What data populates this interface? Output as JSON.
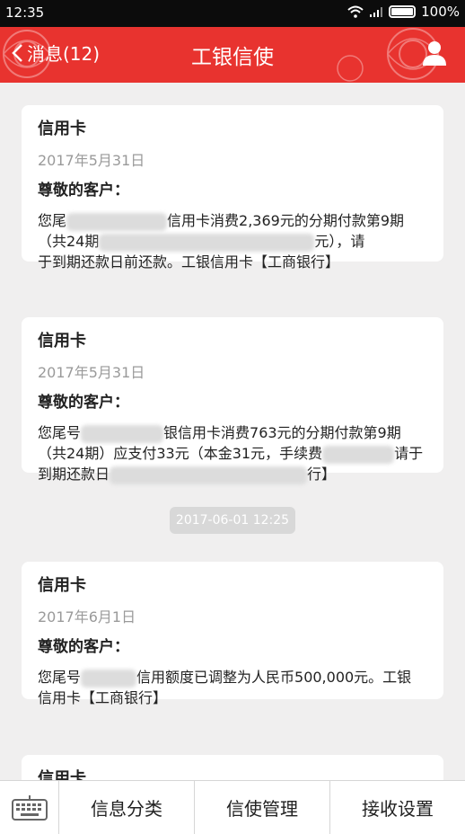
{
  "status_bar": {
    "time": "12:35",
    "battery": "100%"
  },
  "header": {
    "back_label": "消息(12)",
    "title": "工银信使"
  },
  "messages": [
    {
      "title": "信用卡",
      "date": "2017年5月31日",
      "greeting": "尊敬的客户：",
      "line1_a": "您尾",
      "line1_b": "信用卡消费2,369元的分期付款第9期",
      "line2_a": "（共24期",
      "line2_b": "元），请",
      "line3": "于到期还款日前还款。工银信用卡【工商银行】"
    },
    {
      "title": "信用卡",
      "date": "2017年5月31日",
      "greeting": "尊敬的客户：",
      "line1_a": "您尾号",
      "line1_b": "银信用卡消费763元的分期付款第9期",
      "line2_a": "（共24期）应支付33元（本金31元，手续费",
      "line2_b": "请于",
      "line3_a": "到期还款日",
      "line3_b": "行】"
    },
    {
      "title": "信用卡",
      "date": "2017年6月1日",
      "greeting": "尊敬的客户：",
      "line1_a": "您尾号",
      "line1_b": "信用额度已调整为人民币500,000元。工银",
      "line2": "信用卡【工商银行】"
    },
    {
      "title": "信用卡"
    }
  ],
  "time_separator": "2017-06-01 12:25",
  "bottom_bar": {
    "keyboard_icon": "keyboard-icon",
    "items": [
      "信息分类",
      "信使管理",
      "接收设置"
    ]
  },
  "colors": {
    "header_red": "#e8332f",
    "background": "#f0efef"
  }
}
